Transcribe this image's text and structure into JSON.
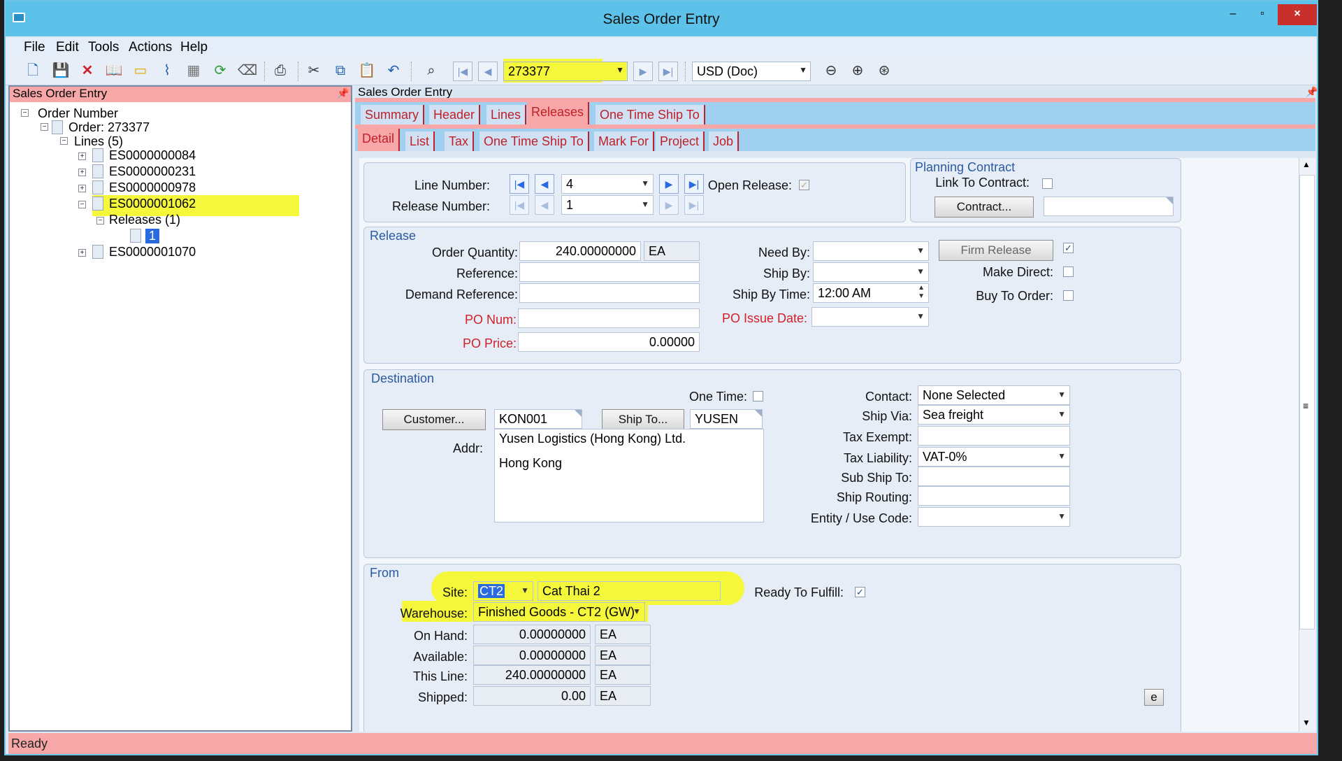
{
  "window": {
    "title": "Sales Order Entry",
    "min": "–",
    "max": "▫",
    "close": "×"
  },
  "menu": [
    "File",
    "Edit",
    "Tools",
    "Actions",
    "Help"
  ],
  "toolbar": {
    "order_number": "273377",
    "currency": "USD (Doc)"
  },
  "left_panel": {
    "title": "Sales Order Entry",
    "tree": {
      "root": "Order Number",
      "order": "Order: 273377",
      "lines": "Lines (5)",
      "items": [
        "ES0000000084",
        "ES0000000231",
        "ES0000000978",
        "ES0000001062",
        "ES0000001070"
      ],
      "releases": "Releases (1)",
      "release_item": "1"
    }
  },
  "right_panel": {
    "title": "Sales Order Entry",
    "tabs1": [
      "Summary",
      "Header",
      "Lines",
      "Releases",
      "One Time Ship To"
    ],
    "tabs2": [
      "Detail",
      "List",
      "Tax",
      "One Time Ship To",
      "Mark For",
      "Project",
      "Job"
    ]
  },
  "top": {
    "line_number_label": "Line Number:",
    "line_number": "4",
    "release_number_label": "Release Number:",
    "release_number": "1",
    "open_release_label": "Open Release:"
  },
  "planning": {
    "title": "Planning Contract",
    "link_label": "Link To Contract:",
    "contract_button": "Contract..."
  },
  "release": {
    "title": "Release",
    "order_qty_label": "Order Quantity:",
    "order_qty": "240.00000000",
    "order_uom": "EA",
    "reference_label": "Reference:",
    "demand_ref_label": "Demand Reference:",
    "po_num_label": "PO Num:",
    "po_price_label": "PO Price:",
    "po_price": "0.00000",
    "need_by_label": "Need By:",
    "ship_by_label": "Ship By:",
    "ship_by_time_label": "Ship By Time:",
    "ship_by_time": "12:00 AM",
    "po_issue_label": "PO Issue Date:",
    "firm_release_button": "Firm Release",
    "make_direct_label": "Make Direct:",
    "buy_to_order_label": "Buy To Order:"
  },
  "destination": {
    "title": "Destination",
    "one_time_label": "One Time:",
    "customer_button": "Customer...",
    "customer": "KON001",
    "ship_to_button": "Ship To...",
    "ship_to": "YUSEN",
    "addr_label": "Addr:",
    "addr_line1": "Yusen Logistics (Hong Kong) Ltd.",
    "addr_line2": "Hong Kong",
    "contact_label": "Contact:",
    "contact": "None Selected",
    "ship_via_label": "Ship Via:",
    "ship_via": "Sea freight",
    "tax_exempt_label": "Tax Exempt:",
    "tax_liability_label": "Tax Liability:",
    "tax_liability": "VAT-0%",
    "sub_ship_label": "Sub Ship To:",
    "ship_routing_label": "Ship Routing:",
    "entity_label": "Entity / Use Code:"
  },
  "from": {
    "title": "From",
    "site_label": "Site:",
    "site": "CT2",
    "site_name": "Cat Thai 2",
    "warehouse_label": "Warehouse:",
    "warehouse": "Finished Goods - CT2 (GW)",
    "ready_label": "Ready To Fulfill:",
    "on_hand_label": "On Hand:",
    "on_hand": "0.00000000",
    "available_label": "Available:",
    "available": "0.00000000",
    "this_line_label": "This Line:",
    "this_line": "240.00000000",
    "shipped_label": "Shipped:",
    "shipped": "0.00",
    "uom": "EA",
    "e_button": "e"
  },
  "status": "Ready"
}
